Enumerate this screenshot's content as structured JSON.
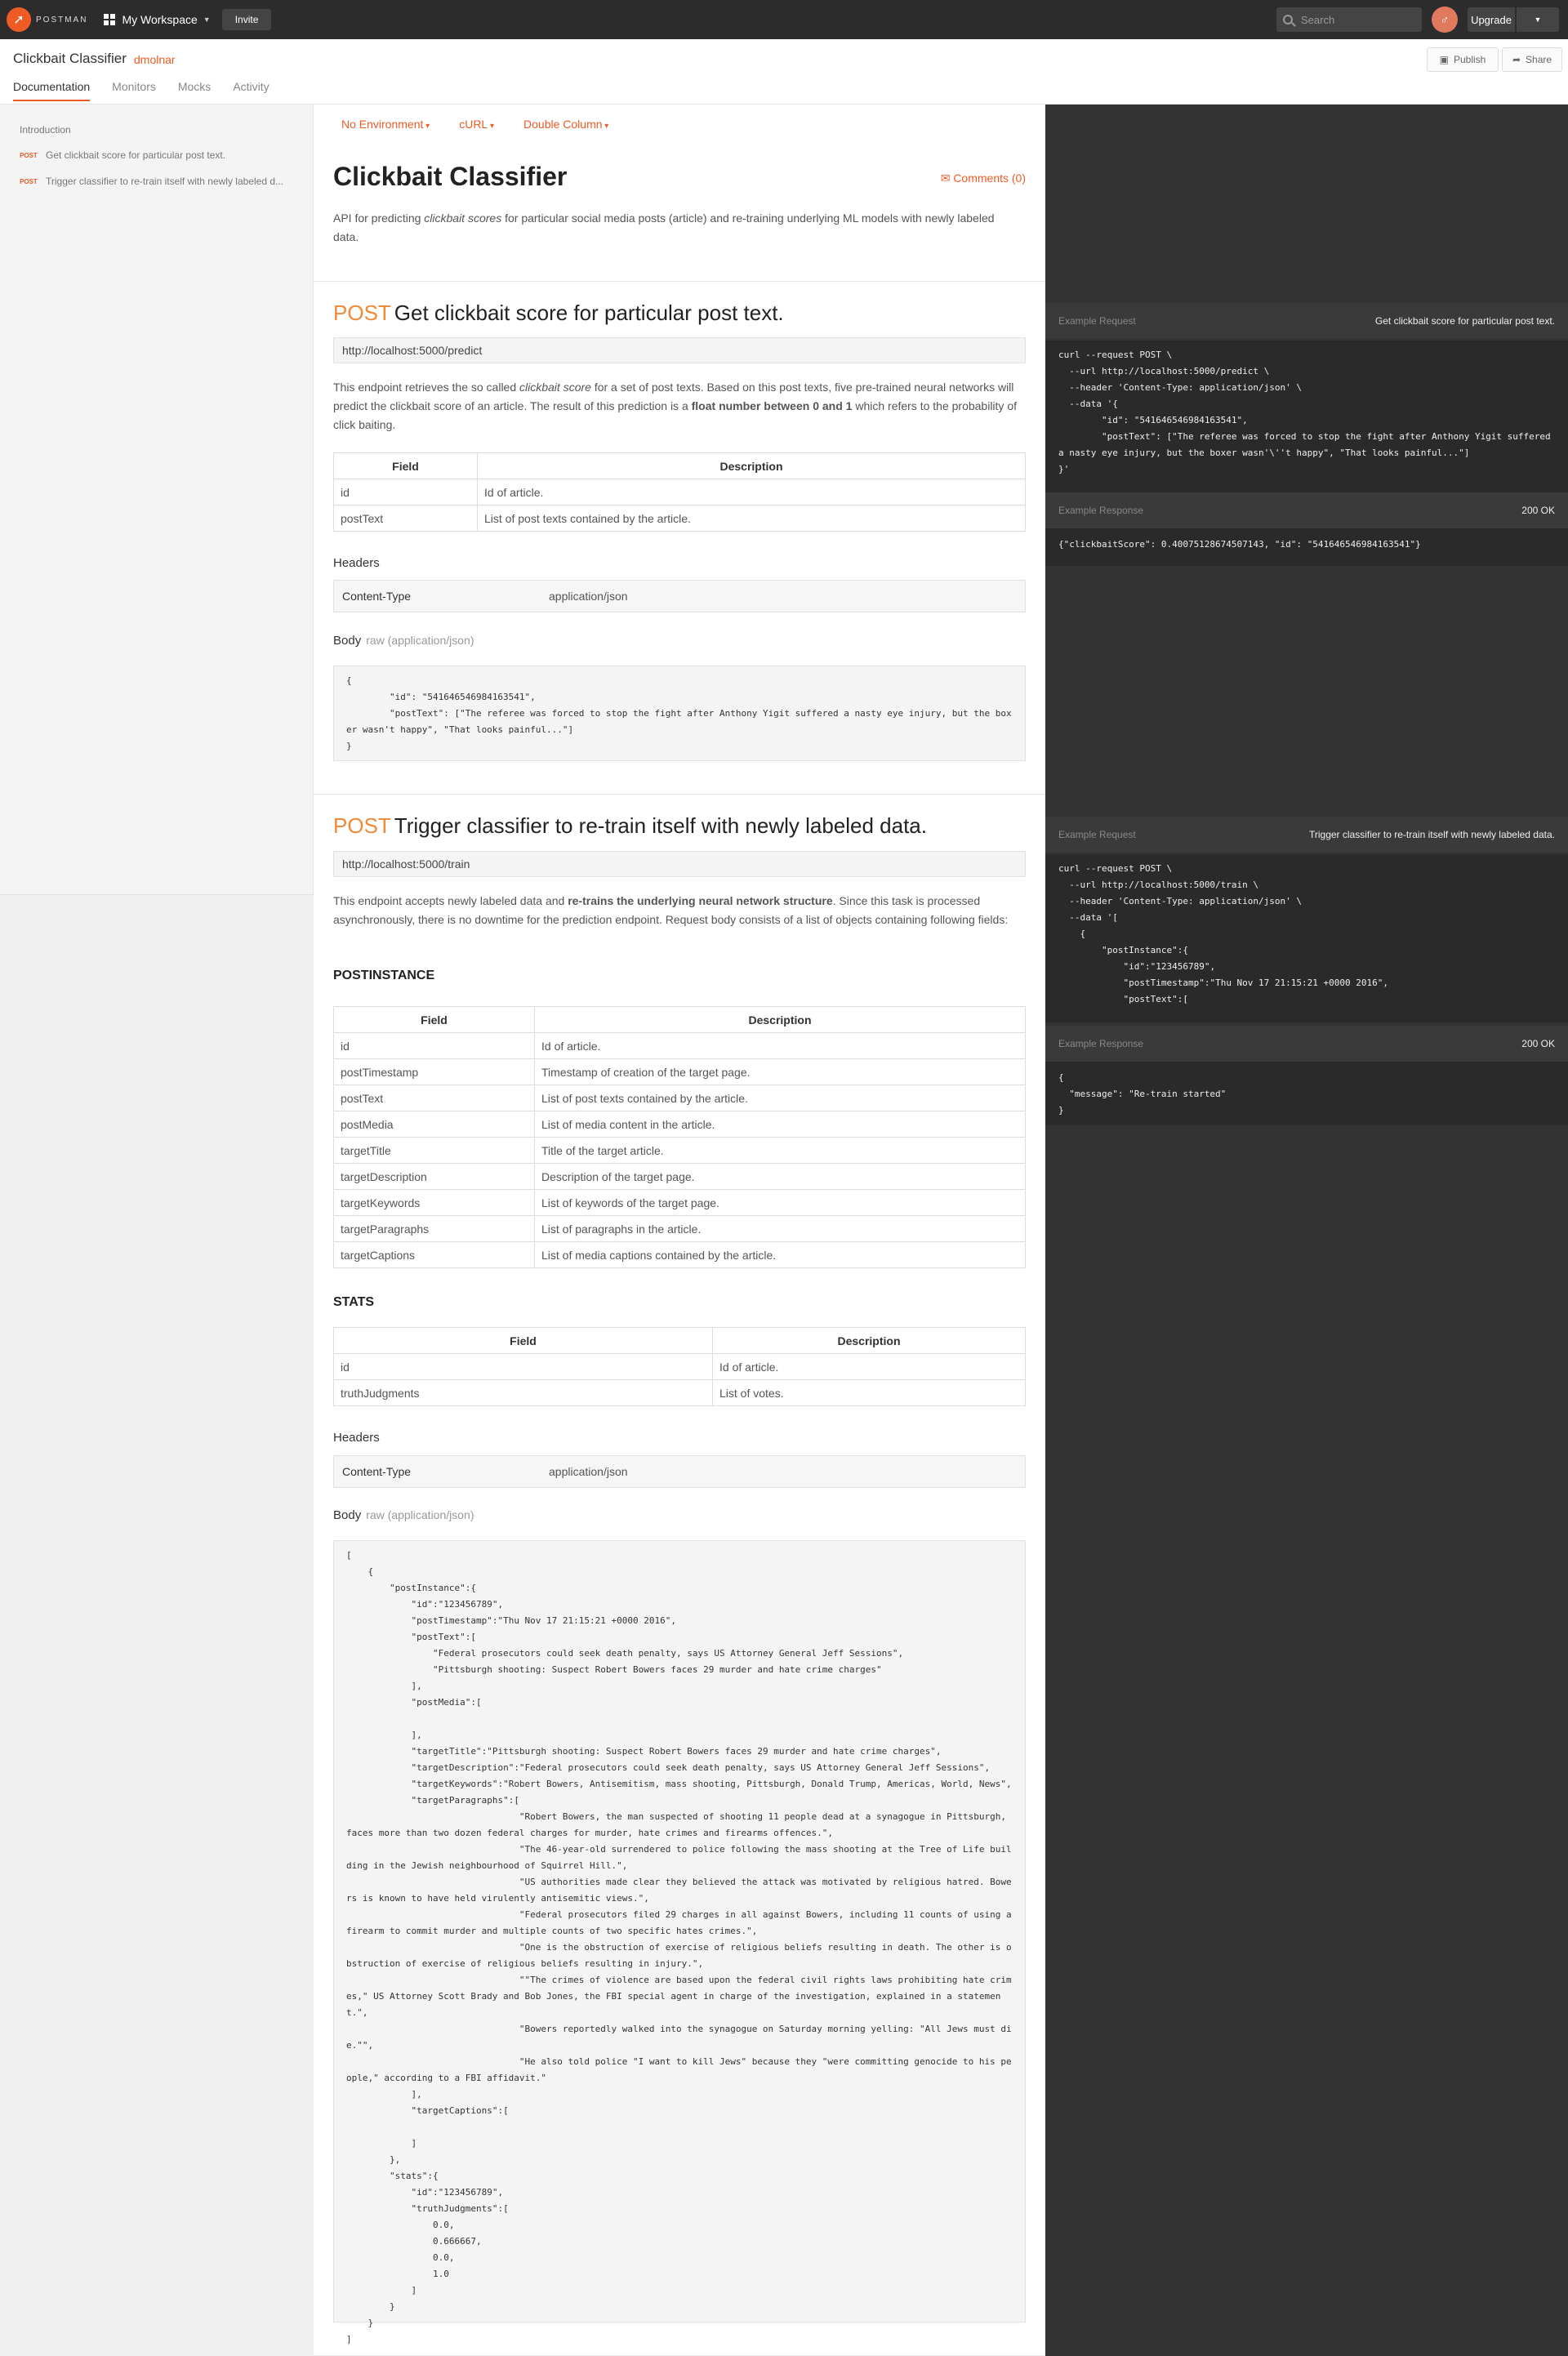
{
  "app": {
    "logo_text": "POSTMAN",
    "workspace": "My Workspace",
    "invite": "Invite",
    "search_placeholder": "Search",
    "upgrade": "Upgrade"
  },
  "collection": {
    "title": "Clickbait Classifier",
    "owner": "dmolnar",
    "publish": "Publish",
    "share": "Share"
  },
  "tabs": [
    "Documentation",
    "Monitors",
    "Mocks",
    "Activity"
  ],
  "sidebar": {
    "intro": "Introduction",
    "items": [
      {
        "method": "POST",
        "label": "Get clickbait score for particular post text."
      },
      {
        "method": "POST",
        "label": "Trigger classifier to re-train itself with newly labeled d..."
      }
    ]
  },
  "toolbar": {
    "environment": "No Environment",
    "language": "cURL",
    "layout": "Double Column"
  },
  "doc": {
    "title": "Clickbait Classifier",
    "comments": "Comments (0)",
    "intro_a": "API for predicting ",
    "intro_em": "clickbait scores",
    "intro_b": " for particular social media posts (article) and re-training underlying ML models with newly labeled data."
  },
  "predict": {
    "method": "POST",
    "title": "Get clickbait score for particular post text.",
    "url": "http://localhost:5000/predict",
    "desc_a": "This endpoint retrieves the so called ",
    "desc_em": "clickbait score",
    "desc_b": " for a set of post texts. Based on this post texts, five pre-trained neural networks will predict the clickbait score of an article. The result of this prediction is a ",
    "desc_strong": "float number between 0 and 1",
    "desc_c": " which refers to the probability of click baiting.",
    "table_header": [
      "Field",
      "Description"
    ],
    "table_rows": [
      [
        "id",
        "Id of article."
      ],
      [
        "postText",
        "List of post texts contained by the article."
      ]
    ],
    "headers_label": "Headers",
    "header_key": "Content-Type",
    "header_value": "application/json",
    "body_label": "Body",
    "body_type": "raw (application/json)",
    "body_code": "{\n        \"id\": \"541646546984163541\",\n        \"postText\": [\"The referee was forced to stop the fight after Anthony Yigit suffered a nasty eye injury, but the boxer wasn't happy\", \"That looks painful...\"]\n}"
  },
  "train": {
    "method": "POST",
    "title": "Trigger classifier to re-train itself with newly labeled data.",
    "url": "http://localhost:5000/train",
    "desc_a": "This endpoint accepts newly labeled data and ",
    "desc_strong": "re-trains the underlying neural network structure",
    "desc_b": ". Since this task is processed asynchronously, there is no downtime for the prediction endpoint. Request body consists of a list of objects containing following fields:",
    "postinstance_heading": "POSTINSTANCE",
    "postinstance_header": [
      "Field",
      "Description"
    ],
    "postinstance_rows": [
      [
        "id",
        "Id of article."
      ],
      [
        "postTimestamp",
        "Timestamp of creation of the target page."
      ],
      [
        "postText",
        "List of post texts contained by the article."
      ],
      [
        "postMedia",
        "List of media content in the article."
      ],
      [
        "targetTitle",
        "Title of the target article."
      ],
      [
        "targetDescription",
        "Description of the target page."
      ],
      [
        "targetKeywords",
        "List of keywords of the target page."
      ],
      [
        "targetParagraphs",
        "List of paragraphs in the article."
      ],
      [
        "targetCaptions",
        "List of media captions contained by the article."
      ]
    ],
    "stats_heading": "STATS",
    "stats_header": [
      "Field",
      "Description"
    ],
    "stats_rows": [
      [
        "id",
        "Id of article."
      ],
      [
        "truthJudgments",
        "List of votes."
      ]
    ],
    "headers_label": "Headers",
    "header_key": "Content-Type",
    "header_value": "application/json",
    "body_label": "Body",
    "body_type": "raw (application/json)",
    "body_code": "[\n    {\n        \"postInstance\":{\n            \"id\":\"123456789\",\n            \"postTimestamp\":\"Thu Nov 17 21:15:21 +0000 2016\",\n            \"postText\":[\n                \"Federal prosecutors could seek death penalty, says US Attorney General Jeff Sessions\",\n                \"Pittsburgh shooting: Suspect Robert Bowers faces 29 murder and hate crime charges\"\n            ],\n            \"postMedia\":[\n\n            ],\n            \"targetTitle\":\"Pittsburgh shooting: Suspect Robert Bowers faces 29 murder and hate crime charges\",\n            \"targetDescription\":\"Federal prosecutors could seek death penalty, says US Attorney General Jeff Sessions\",\n            \"targetKeywords\":\"Robert Bowers, Antisemitism, mass shooting, Pittsburgh, Donald Trump, Americas, World, News\",\n            \"targetParagraphs\":[\n                                \"Robert Bowers, the man suspected of shooting 11 people dead at a synagogue in Pittsburgh, faces more than two dozen federal charges for murder, hate crimes and firearms offences.\",\n                                \"The 46-year-old surrendered to police following the mass shooting at the Tree of Life building in the Jewish neighbourhood of Squirrel Hill.\",\n                                \"US authorities made clear they believed the attack was motivated by religious hatred. Bowers is known to have held virulently antisemitic views.\",\n                                \"Federal prosecutors filed 29 charges in all against Bowers, including 11 counts of using a firearm to commit murder and multiple counts of two specific hates crimes.\",\n                                \"One is the obstruction of exercise of religious beliefs resulting in death. The other is obstruction of exercise of religious beliefs resulting in injury.\",\n                                \"\"The crimes of violence are based upon the federal civil rights laws prohibiting hate crimes,\" US Attorney Scott Brady and Bob Jones, the FBI special agent in charge of the investigation, explained in a statement.\",\n                                \"Bowers reportedly walked into the synagogue on Saturday morning yelling: \"All Jews must die.\"\",\n                                \"He also told police \"I want to kill Jews\" because they \"were committing genocide to his people,\" according to a FBI affidavit.\"\n            ],\n            \"targetCaptions\":[\n\n            ]\n        },\n        \"stats\":{\n            \"id\":\"123456789\",\n            \"truthJudgments\":[\n                0.0,\n                0.666667,\n                0.0,\n                1.0\n            ]\n        }\n    }\n]"
  },
  "right_panel": {
    "predict_request_label": "Example Request",
    "predict_request_title": "Get clickbait score for particular post text.",
    "predict_request_code": "curl --request POST \\\n  --url http://localhost:5000/predict \\\n  --header 'Content-Type: application/json' \\\n  --data '{\n        \"id\": \"541646546984163541\",\n        \"postText\": [\"The referee was forced to stop the fight after Anthony Yigit suffered a nasty eye injury, but the boxer wasn'\\''t happy\", \"That looks painful...\"]\n}'",
    "predict_response_label": "Example Response",
    "predict_response_status": "200 OK",
    "predict_response_code": "{\"clickbaitScore\": 0.40075128674507143, \"id\": \"541646546984163541\"}",
    "train_request_label": "Example Request",
    "train_request_title": "Trigger classifier to re-train itself with newly labeled data.",
    "train_request_code": "curl --request POST \\\n  --url http://localhost:5000/train \\\n  --header 'Content-Type: application/json' \\\n  --data '[\n    {\n        \"postInstance\":{\n            \"id\":\"123456789\",\n            \"postTimestamp\":\"Thu Nov 17 21:15:21 +0000 2016\",\n            \"postText\":[",
    "train_response_label": "Example Response",
    "train_response_status": "200 OK",
    "train_response_code": "{\n  \"message\": \"Re-train started\"\n}"
  },
  "colors": {
    "accent": "#ef5b25",
    "method": "#ef8a39",
    "dark_panel": "#333333",
    "topbar": "#2c2c2c"
  }
}
